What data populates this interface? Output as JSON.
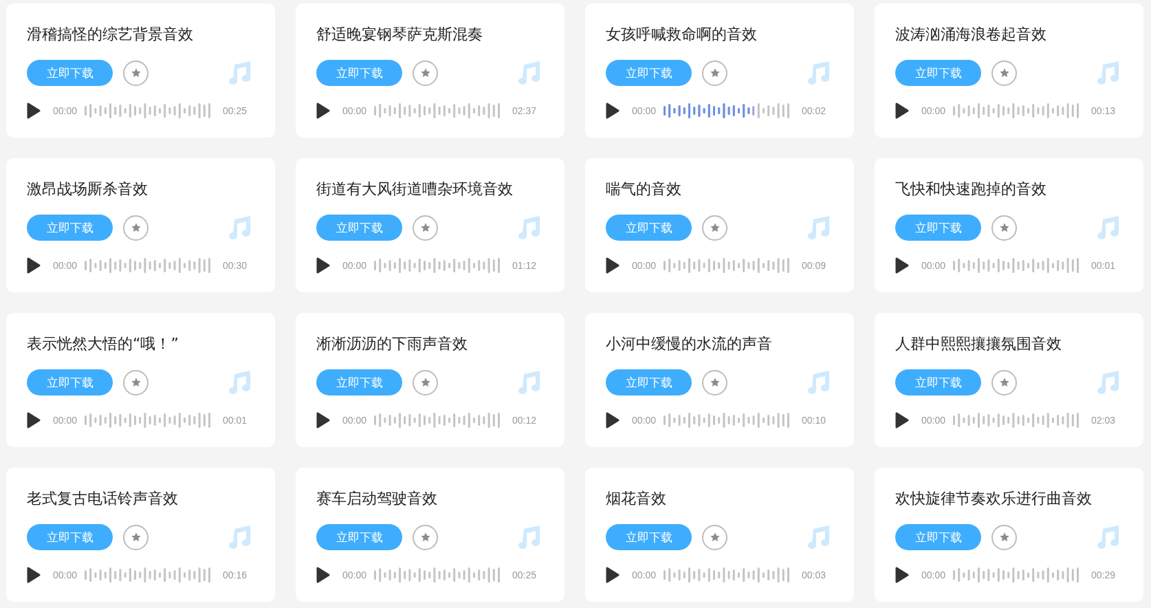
{
  "cards": [
    {
      "title": "滑稽搞怪的综艺背景音效",
      "download": "立即下载",
      "start": "00:00",
      "end": "00:25"
    },
    {
      "title": "舒适晚宴钢琴萨克斯混奏",
      "download": "立即下载",
      "start": "00:00",
      "end": "02:37"
    },
    {
      "title": "女孩呼喊救命啊的音效",
      "download": "立即下载",
      "start": "00:00",
      "end": "00:02",
      "level": 0.7
    },
    {
      "title": "波涛汹涌海浪卷起音效",
      "download": "立即下载",
      "start": "00:00",
      "end": "00:13"
    },
    {
      "title": "激昂战场厮杀音效",
      "download": "立即下载",
      "start": "00:00",
      "end": "00:30"
    },
    {
      "title": "街道有大风街道嘈杂环境音效",
      "download": "立即下载",
      "start": "00:00",
      "end": "01:12"
    },
    {
      "title": "喘气的音效",
      "download": "立即下载",
      "start": "00:00",
      "end": "00:09"
    },
    {
      "title": "飞快和快速跑掉的音效",
      "download": "立即下载",
      "start": "00:00",
      "end": "00:01"
    },
    {
      "title": "表示恍然大悟的“哦！”",
      "download": "立即下载",
      "start": "00:00",
      "end": "00:01"
    },
    {
      "title": "淅淅沥沥的下雨声音效",
      "download": "立即下载",
      "start": "00:00",
      "end": "00:12"
    },
    {
      "title": "小河中缓慢的水流的声音",
      "download": "立即下载",
      "start": "00:00",
      "end": "00:10"
    },
    {
      "title": "人群中熙熙攘攘氛围音效",
      "download": "立即下载",
      "start": "00:00",
      "end": "02:03"
    },
    {
      "title": "老式复古电话铃声音效",
      "download": "立即下载",
      "start": "00:00",
      "end": "00:16"
    },
    {
      "title": "赛车启动驾驶音效",
      "download": "立即下载",
      "start": "00:00",
      "end": "00:25"
    },
    {
      "title": "烟花音效",
      "download": "立即下载",
      "start": "00:00",
      "end": "00:03"
    },
    {
      "title": "欢快旋律节奏欢乐进行曲音效",
      "download": "立即下载",
      "start": "00:00",
      "end": "00:29"
    }
  ]
}
